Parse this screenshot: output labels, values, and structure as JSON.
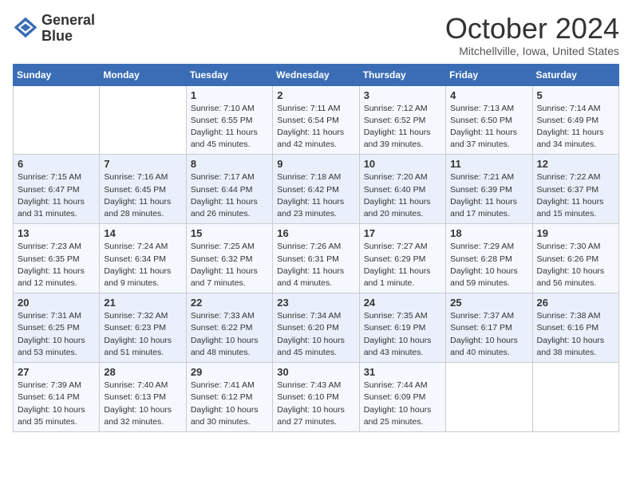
{
  "logo": {
    "line1": "General",
    "line2": "Blue"
  },
  "title": "October 2024",
  "location": "Mitchellville, Iowa, United States",
  "days_header": [
    "Sunday",
    "Monday",
    "Tuesday",
    "Wednesday",
    "Thursday",
    "Friday",
    "Saturday"
  ],
  "weeks": [
    [
      {
        "day": "",
        "sunrise": "",
        "sunset": "",
        "daylight": ""
      },
      {
        "day": "",
        "sunrise": "",
        "sunset": "",
        "daylight": ""
      },
      {
        "day": "1",
        "sunrise": "Sunrise: 7:10 AM",
        "sunset": "Sunset: 6:55 PM",
        "daylight": "Daylight: 11 hours and 45 minutes."
      },
      {
        "day": "2",
        "sunrise": "Sunrise: 7:11 AM",
        "sunset": "Sunset: 6:54 PM",
        "daylight": "Daylight: 11 hours and 42 minutes."
      },
      {
        "day": "3",
        "sunrise": "Sunrise: 7:12 AM",
        "sunset": "Sunset: 6:52 PM",
        "daylight": "Daylight: 11 hours and 39 minutes."
      },
      {
        "day": "4",
        "sunrise": "Sunrise: 7:13 AM",
        "sunset": "Sunset: 6:50 PM",
        "daylight": "Daylight: 11 hours and 37 minutes."
      },
      {
        "day": "5",
        "sunrise": "Sunrise: 7:14 AM",
        "sunset": "Sunset: 6:49 PM",
        "daylight": "Daylight: 11 hours and 34 minutes."
      }
    ],
    [
      {
        "day": "6",
        "sunrise": "Sunrise: 7:15 AM",
        "sunset": "Sunset: 6:47 PM",
        "daylight": "Daylight: 11 hours and 31 minutes."
      },
      {
        "day": "7",
        "sunrise": "Sunrise: 7:16 AM",
        "sunset": "Sunset: 6:45 PM",
        "daylight": "Daylight: 11 hours and 28 minutes."
      },
      {
        "day": "8",
        "sunrise": "Sunrise: 7:17 AM",
        "sunset": "Sunset: 6:44 PM",
        "daylight": "Daylight: 11 hours and 26 minutes."
      },
      {
        "day": "9",
        "sunrise": "Sunrise: 7:18 AM",
        "sunset": "Sunset: 6:42 PM",
        "daylight": "Daylight: 11 hours and 23 minutes."
      },
      {
        "day": "10",
        "sunrise": "Sunrise: 7:20 AM",
        "sunset": "Sunset: 6:40 PM",
        "daylight": "Daylight: 11 hours and 20 minutes."
      },
      {
        "day": "11",
        "sunrise": "Sunrise: 7:21 AM",
        "sunset": "Sunset: 6:39 PM",
        "daylight": "Daylight: 11 hours and 17 minutes."
      },
      {
        "day": "12",
        "sunrise": "Sunrise: 7:22 AM",
        "sunset": "Sunset: 6:37 PM",
        "daylight": "Daylight: 11 hours and 15 minutes."
      }
    ],
    [
      {
        "day": "13",
        "sunrise": "Sunrise: 7:23 AM",
        "sunset": "Sunset: 6:35 PM",
        "daylight": "Daylight: 11 hours and 12 minutes."
      },
      {
        "day": "14",
        "sunrise": "Sunrise: 7:24 AM",
        "sunset": "Sunset: 6:34 PM",
        "daylight": "Daylight: 11 hours and 9 minutes."
      },
      {
        "day": "15",
        "sunrise": "Sunrise: 7:25 AM",
        "sunset": "Sunset: 6:32 PM",
        "daylight": "Daylight: 11 hours and 7 minutes."
      },
      {
        "day": "16",
        "sunrise": "Sunrise: 7:26 AM",
        "sunset": "Sunset: 6:31 PM",
        "daylight": "Daylight: 11 hours and 4 minutes."
      },
      {
        "day": "17",
        "sunrise": "Sunrise: 7:27 AM",
        "sunset": "Sunset: 6:29 PM",
        "daylight": "Daylight: 11 hours and 1 minute."
      },
      {
        "day": "18",
        "sunrise": "Sunrise: 7:29 AM",
        "sunset": "Sunset: 6:28 PM",
        "daylight": "Daylight: 10 hours and 59 minutes."
      },
      {
        "day": "19",
        "sunrise": "Sunrise: 7:30 AM",
        "sunset": "Sunset: 6:26 PM",
        "daylight": "Daylight: 10 hours and 56 minutes."
      }
    ],
    [
      {
        "day": "20",
        "sunrise": "Sunrise: 7:31 AM",
        "sunset": "Sunset: 6:25 PM",
        "daylight": "Daylight: 10 hours and 53 minutes."
      },
      {
        "day": "21",
        "sunrise": "Sunrise: 7:32 AM",
        "sunset": "Sunset: 6:23 PM",
        "daylight": "Daylight: 10 hours and 51 minutes."
      },
      {
        "day": "22",
        "sunrise": "Sunrise: 7:33 AM",
        "sunset": "Sunset: 6:22 PM",
        "daylight": "Daylight: 10 hours and 48 minutes."
      },
      {
        "day": "23",
        "sunrise": "Sunrise: 7:34 AM",
        "sunset": "Sunset: 6:20 PM",
        "daylight": "Daylight: 10 hours and 45 minutes."
      },
      {
        "day": "24",
        "sunrise": "Sunrise: 7:35 AM",
        "sunset": "Sunset: 6:19 PM",
        "daylight": "Daylight: 10 hours and 43 minutes."
      },
      {
        "day": "25",
        "sunrise": "Sunrise: 7:37 AM",
        "sunset": "Sunset: 6:17 PM",
        "daylight": "Daylight: 10 hours and 40 minutes."
      },
      {
        "day": "26",
        "sunrise": "Sunrise: 7:38 AM",
        "sunset": "Sunset: 6:16 PM",
        "daylight": "Daylight: 10 hours and 38 minutes."
      }
    ],
    [
      {
        "day": "27",
        "sunrise": "Sunrise: 7:39 AM",
        "sunset": "Sunset: 6:14 PM",
        "daylight": "Daylight: 10 hours and 35 minutes."
      },
      {
        "day": "28",
        "sunrise": "Sunrise: 7:40 AM",
        "sunset": "Sunset: 6:13 PM",
        "daylight": "Daylight: 10 hours and 32 minutes."
      },
      {
        "day": "29",
        "sunrise": "Sunrise: 7:41 AM",
        "sunset": "Sunset: 6:12 PM",
        "daylight": "Daylight: 10 hours and 30 minutes."
      },
      {
        "day": "30",
        "sunrise": "Sunrise: 7:43 AM",
        "sunset": "Sunset: 6:10 PM",
        "daylight": "Daylight: 10 hours and 27 minutes."
      },
      {
        "day": "31",
        "sunrise": "Sunrise: 7:44 AM",
        "sunset": "Sunset: 6:09 PM",
        "daylight": "Daylight: 10 hours and 25 minutes."
      },
      {
        "day": "",
        "sunrise": "",
        "sunset": "",
        "daylight": ""
      },
      {
        "day": "",
        "sunrise": "",
        "sunset": "",
        "daylight": ""
      }
    ]
  ]
}
